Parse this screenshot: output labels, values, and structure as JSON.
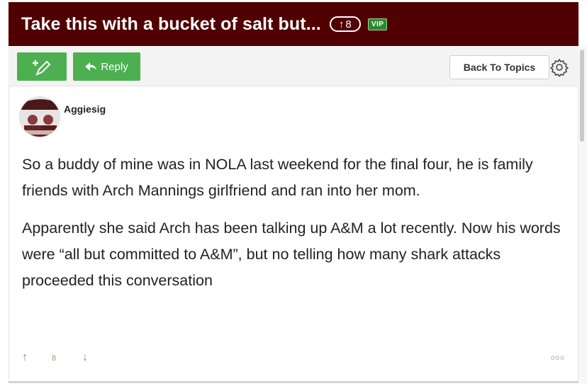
{
  "topic": {
    "title": "Take this with a bucket of salt but...",
    "vote_count": "8",
    "vip_label": "VIP"
  },
  "toolbar": {
    "reply_label": "Reply",
    "back_label": "Back To Topics"
  },
  "post": {
    "username": "Aggiesig",
    "paragraphs": [
      "So a buddy of mine was in NOLA last weekend for the final four, he is family friends with Arch Mannings girlfriend and ran into her mom.",
      "Apparently she said Arch has been talking up A&M a lot recently. Now his words were “all but committed to A&M”, but no telling how many shark attacks proceeded this conversation"
    ],
    "votes": "8"
  },
  "colors": {
    "title_bar": "#500000",
    "button_green": "#4caf50"
  },
  "icons": [
    "new-topic-icon",
    "reply-arrow-icon",
    "gear-icon",
    "up-arrow-icon",
    "down-arrow-icon",
    "more-options-icon",
    "avatar"
  ]
}
